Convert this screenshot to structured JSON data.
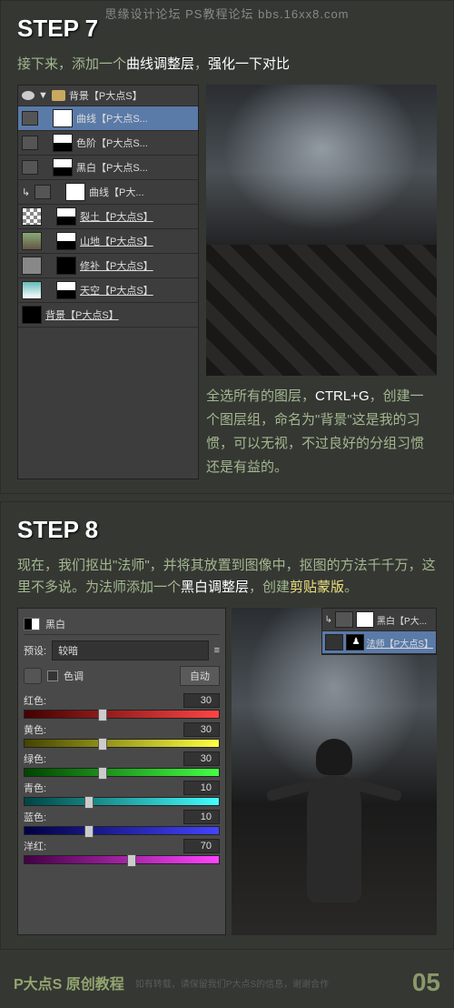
{
  "watermark": "思缘设计论坛   PS教程论坛   bbs.16xx8.com",
  "step7": {
    "title": "STEP 7",
    "desc_p1a": "接下来，添加一个",
    "desc_p1b": "曲线调整层",
    "desc_p1c": "，",
    "desc_p1d": "强化一下对比",
    "group": "背景【P大点S】",
    "layers": [
      {
        "name": "曲线【P大点S..."
      },
      {
        "name": "色阶【P大点S..."
      },
      {
        "name": "黑白【P大点S..."
      },
      {
        "name": "曲线【P大..."
      },
      {
        "name": "裂土【P大点S】",
        "ul": true
      },
      {
        "name": "山地【P大点S】",
        "ul": true
      },
      {
        "name": "修补【P大点S】",
        "ul": true
      },
      {
        "name": "天空【P大点S】",
        "ul": true
      },
      {
        "name": "背景【P大点S】",
        "ul": true
      }
    ],
    "desc2_a": "全选所有的图层，",
    "desc2_b": "CTRL+G",
    "desc2_c": "，创建一个图层组，命名为\"背景\"这是我的习惯，可以无视，不过良好的分组习惯还是有益的。"
  },
  "step8": {
    "title": "STEP 8",
    "desc_a": "现在，我们抠出\"法师\"，并将其放置到图像中，抠图的方法千千万，这里不多说。为法师添加一个",
    "desc_b": "黑白调整层",
    "desc_c": "，创建",
    "desc_d": "剪贴蒙版",
    "desc_e": "。",
    "bw_title": "黑白",
    "preset_lbl": "预设:",
    "preset_val": "较暗",
    "tint": "色调",
    "auto": "自动",
    "sliders": [
      {
        "label": "红色:",
        "val": 30,
        "grad": "linear-gradient(90deg,#400,#f44)",
        "pos": 40
      },
      {
        "label": "黄色:",
        "val": 30,
        "grad": "linear-gradient(90deg,#440,#ff4)",
        "pos": 40
      },
      {
        "label": "绿色:",
        "val": 30,
        "grad": "linear-gradient(90deg,#040,#4f4)",
        "pos": 40
      },
      {
        "label": "青色:",
        "val": 10,
        "grad": "linear-gradient(90deg,#044,#4ff)",
        "pos": 33
      },
      {
        "label": "蓝色:",
        "val": 10,
        "grad": "linear-gradient(90deg,#004,#44f)",
        "pos": 33
      },
      {
        "label": "洋红:",
        "val": 70,
        "grad": "linear-gradient(90deg,#404,#f4f)",
        "pos": 55
      }
    ],
    "mini": [
      {
        "name": "黑白【P大..."
      },
      {
        "name": "法师【P大点S】",
        "ul": true
      }
    ]
  },
  "footer": {
    "title": "P大点S 原创教程",
    "note": "如有转载，请保留我们P大点S的信息，谢谢合作",
    "page": "05"
  }
}
